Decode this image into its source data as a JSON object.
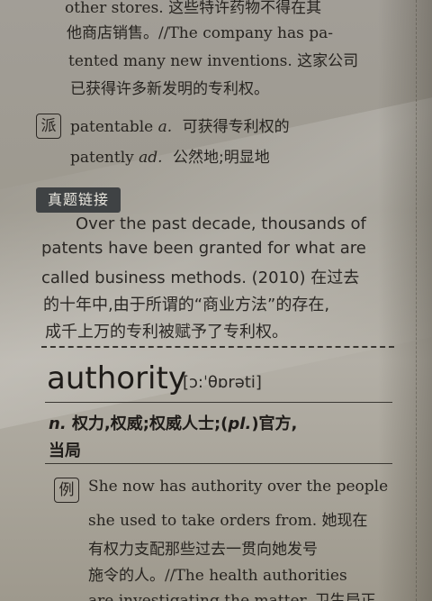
{
  "top_lines": [
    "other stores. 这些特许药物不得在其",
    "他商店销售。//The company has pa-",
    "tented many new inventions. 这家公司",
    "已获得许多新发明的专利权。"
  ],
  "derived": {
    "tag": "派",
    "word": "patentable",
    "pos": "a.",
    "meaning": "可获得专利权的",
    "word2": "patently",
    "pos2": "ad.",
    "meaning2": "公然地;明显地"
  },
  "zhenti_label": "真题链接",
  "example_block": [
    "Over the past decade, thousands of",
    "patents have been granted for what are",
    "called business methods. (2010) 在过去",
    "的十年中,由于所谓的“商业方法”的存在,",
    "成千上万的专利被赋予了专利权。"
  ],
  "entry": {
    "headword": "authority",
    "phonetic": "[ɔ:ˈθɒrəti]",
    "definition_pos": "n.",
    "definition_line1": "权力,权威;权威人士;(",
    "definition_pl": "pl.",
    "definition_line1_end": ")官方,",
    "definition_line2": "当局"
  },
  "example2": {
    "tag": "例",
    "lines": [
      "She now has authority over the people",
      "she used to take orders from. 她现在",
      "有权力支配那些过去一贯向她发号",
      "施令的人。//The health authorities",
      "are investigating the matter. 卫生局正"
    ]
  }
}
